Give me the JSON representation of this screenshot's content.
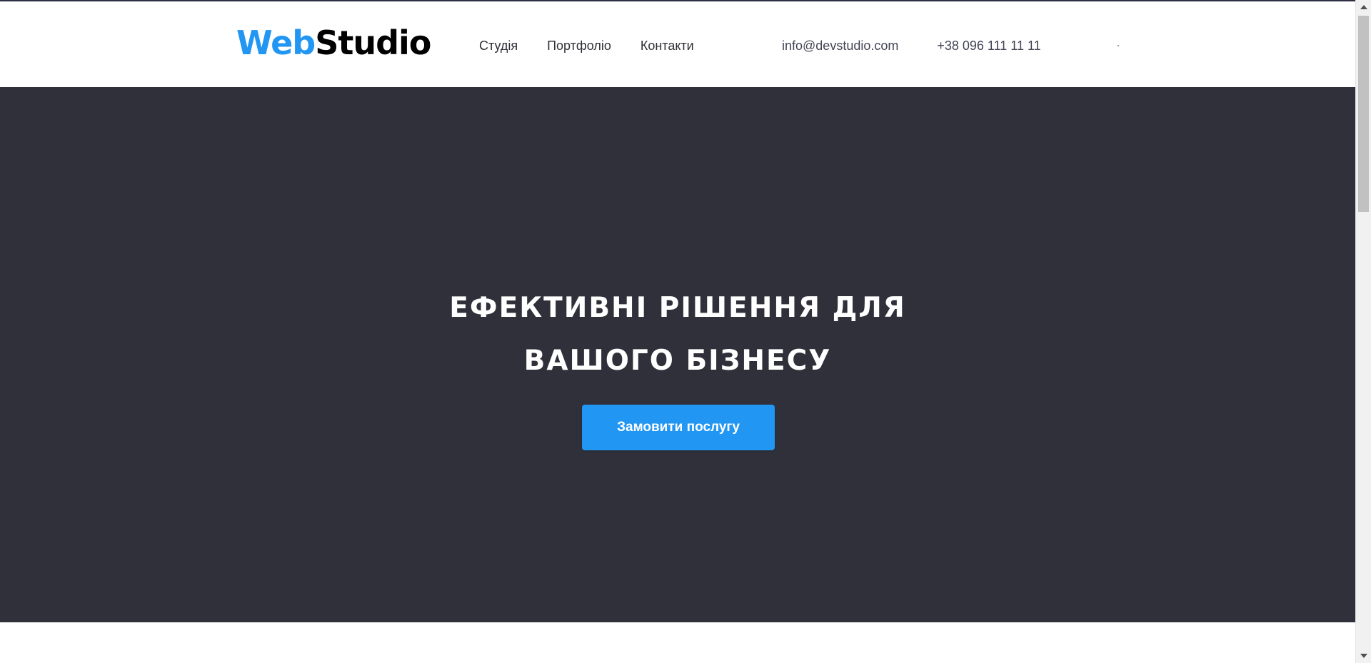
{
  "header": {
    "logo": {
      "part1": "Web",
      "part2": "Studio"
    },
    "nav": [
      {
        "label": "Студія"
      },
      {
        "label": "Портфоліо"
      },
      {
        "label": "Контакти"
      }
    ],
    "contacts": {
      "email": "info@devstudio.com",
      "phone": "+38 096 111 11 11"
    }
  },
  "hero": {
    "title_line1": "ЕФЕКТИВНІ РІШЕННЯ ДЛЯ",
    "title_line2": "ВАШОГО БІЗНЕСУ",
    "button_label": "Замовити послугу"
  },
  "colors": {
    "accent": "#2196f3",
    "hero_bg": "#2f303a",
    "text_dark": "#2f2f37",
    "text_muted": "#434455"
  }
}
